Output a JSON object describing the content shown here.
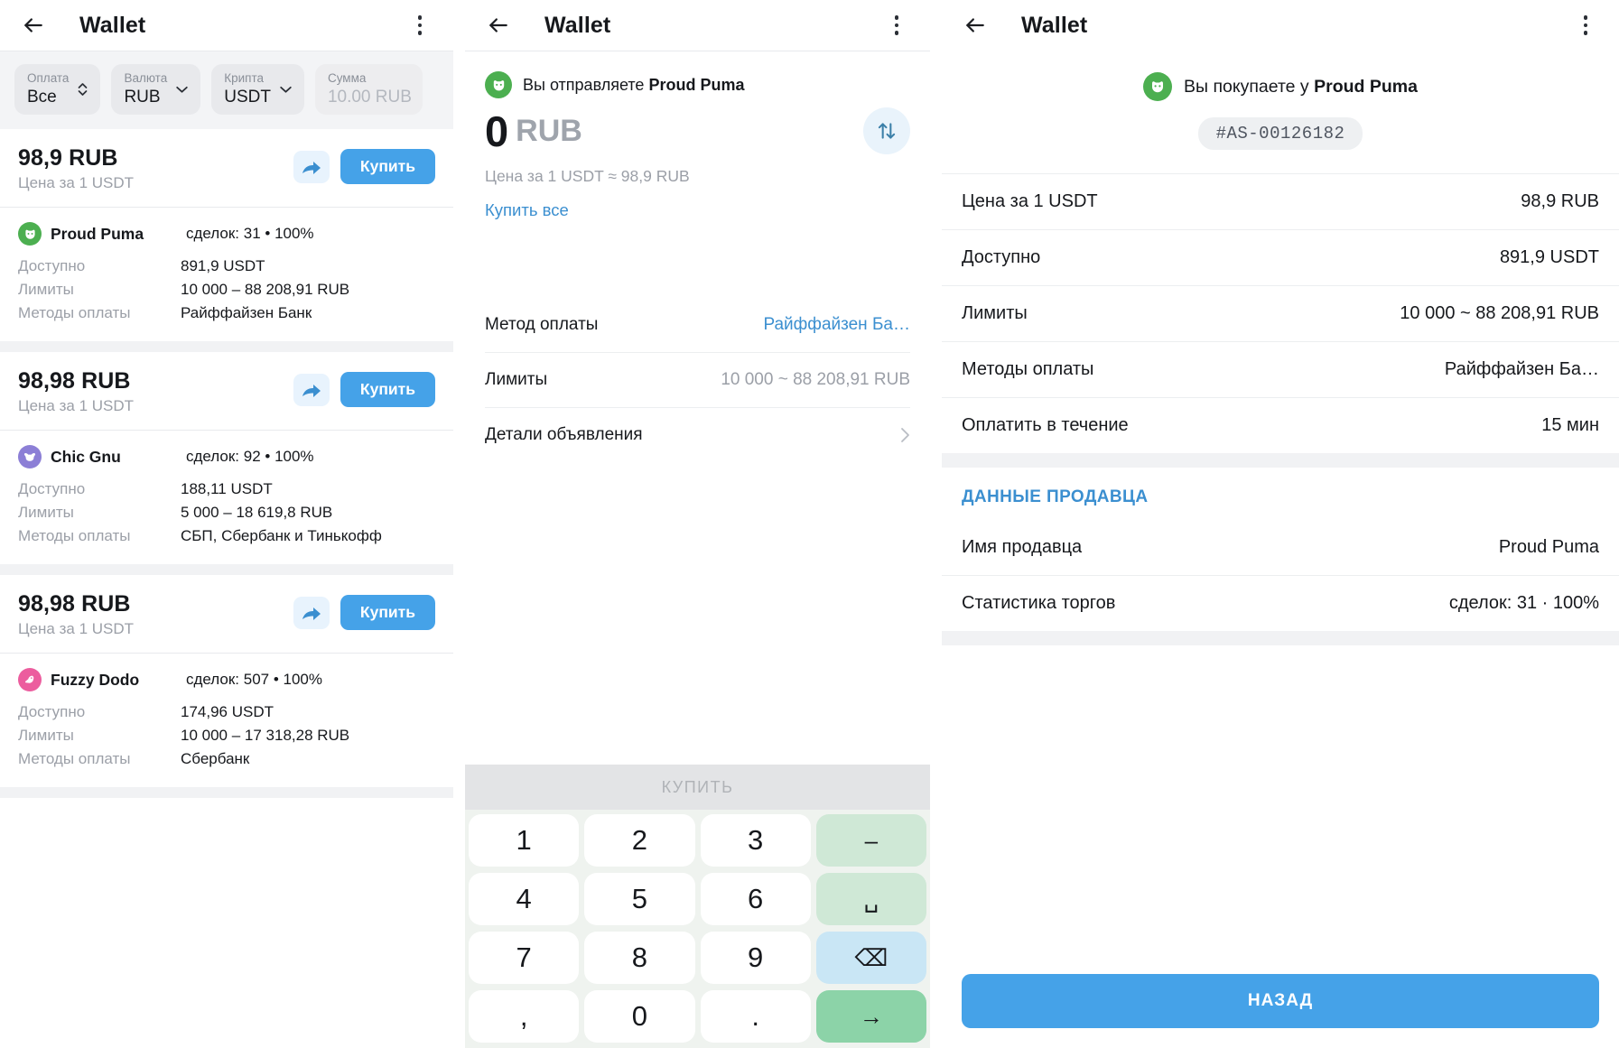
{
  "app": {
    "title": "Wallet",
    "accent_blue": "#45a2e8",
    "link_blue": "#3b8fd0",
    "muted_gray": "#9b9fa7",
    "back_icon": "back-arrow-icon",
    "menu_icon": "kebab-menu-icon"
  },
  "panel1": {
    "filters": [
      {
        "label": "Оплата",
        "value": "Все",
        "icon": "updown-chevron-icon",
        "muted": false
      },
      {
        "label": "Валюта",
        "value": "RUB",
        "icon": "chevron-down-icon",
        "muted": false
      },
      {
        "label": "Крипта",
        "value": "USDT",
        "icon": "chevron-down-icon",
        "muted": false
      },
      {
        "label": "Сумма",
        "value": "10.00 RUB",
        "icon": "none",
        "muted": true
      }
    ],
    "labels": {
      "price_sub": "Цена за 1 USDT",
      "available": "Доступно",
      "limits": "Лимиты",
      "payment_methods": "Методы оплаты",
      "buy_button": "Купить",
      "share_icon": "share-arrow-icon"
    },
    "offers": [
      {
        "price": "98,9 RUB",
        "merchant": "Proud Puma",
        "avatar_color": "#4caf50",
        "avatar_icon": "puma-avatar-icon",
        "stats": "сделок: 31 • 100%",
        "available": "891,9 USDT",
        "limits": "10 000 – 88 208,91 RUB",
        "methods": "Райффайзен Банк"
      },
      {
        "price": "98,98 RUB",
        "merchant": "Chic Gnu",
        "avatar_color": "#8c7fd6",
        "avatar_icon": "gnu-avatar-icon",
        "stats": "сделок: 92 • 100%",
        "available": "188,11 USDT",
        "limits": "5 000 – 18 619,8 RUB",
        "methods": "СБП, Сбербанк и Тинькофф"
      },
      {
        "price": "98,98 RUB",
        "merchant": "Fuzzy Dodo",
        "avatar_color": "#ec5d9e",
        "avatar_icon": "dodo-avatar-icon",
        "stats": "сделок: 507 • 100%",
        "available": "174,96 USDT",
        "limits": "10 000 – 17 318,28 RUB",
        "methods": "Сбербанк"
      }
    ]
  },
  "panel2": {
    "seller_prefix": "Вы отправляете ",
    "seller_name": "Proud Puma",
    "avatar_color": "#4caf50",
    "avatar_icon": "puma-avatar-icon",
    "amount": "0",
    "currency": "RUB",
    "rate_line": "Цена за 1 USDT ≈ 98,9 RUB",
    "buy_all": "Купить все",
    "swap_icon": "swap-vertical-icon",
    "rows": [
      {
        "key": "Метод оплаты",
        "value": "Райффайзен Ба…",
        "style": "link"
      },
      {
        "key": "Лимиты",
        "value": "10 000 ~ 88 208,91 RUB",
        "style": "muted"
      },
      {
        "key": "Детали объявления",
        "value": "",
        "style": "chevron"
      }
    ],
    "keypad": {
      "header": "КУПИТЬ",
      "keys": [
        {
          "label": "1",
          "kind": "num",
          "name": "key-1"
        },
        {
          "label": "2",
          "kind": "num",
          "name": "key-2"
        },
        {
          "label": "3",
          "kind": "num",
          "name": "key-3"
        },
        {
          "label": "–",
          "kind": "fn",
          "name": "key-minus"
        },
        {
          "label": "4",
          "kind": "num",
          "name": "key-4"
        },
        {
          "label": "5",
          "kind": "num",
          "name": "key-5"
        },
        {
          "label": "6",
          "kind": "num",
          "name": "key-6"
        },
        {
          "label": "␣",
          "kind": "fn",
          "name": "key-space"
        },
        {
          "label": "7",
          "kind": "num",
          "name": "key-7"
        },
        {
          "label": "8",
          "kind": "num",
          "name": "key-8"
        },
        {
          "label": "9",
          "kind": "num",
          "name": "key-9"
        },
        {
          "label": "⌫",
          "kind": "del",
          "name": "key-backspace"
        },
        {
          "label": ",",
          "kind": "num",
          "name": "key-comma"
        },
        {
          "label": "0",
          "kind": "num",
          "name": "key-0"
        },
        {
          "label": ".",
          "kind": "num",
          "name": "key-period"
        },
        {
          "label": "→",
          "kind": "enter",
          "name": "key-enter"
        }
      ]
    }
  },
  "panel3": {
    "seller_prefix": "Вы покупаете у ",
    "seller_name": "Proud Puma",
    "avatar_color": "#4caf50",
    "avatar_icon": "puma-avatar-icon",
    "order_id": "#AS-00126182",
    "rows": [
      {
        "key": "Цена за 1 USDT",
        "value": "98,9 RUB"
      },
      {
        "key": "Доступно",
        "value": "891,9 USDT"
      },
      {
        "key": "Лимиты",
        "value": "10 000 ~ 88 208,91 RUB"
      },
      {
        "key": "Методы оплаты",
        "value": "Райффайзен Ба…"
      },
      {
        "key": "Оплатить в течение",
        "value": "15 мин"
      }
    ],
    "section_title": "ДАННЫЕ ПРОДАВЦА",
    "seller_rows": [
      {
        "key": "Имя продавца",
        "value": "Proud Puma"
      },
      {
        "key": "Статистика торгов",
        "value": "сделок: 31 · 100%"
      }
    ],
    "back_button": "НАЗАД"
  }
}
